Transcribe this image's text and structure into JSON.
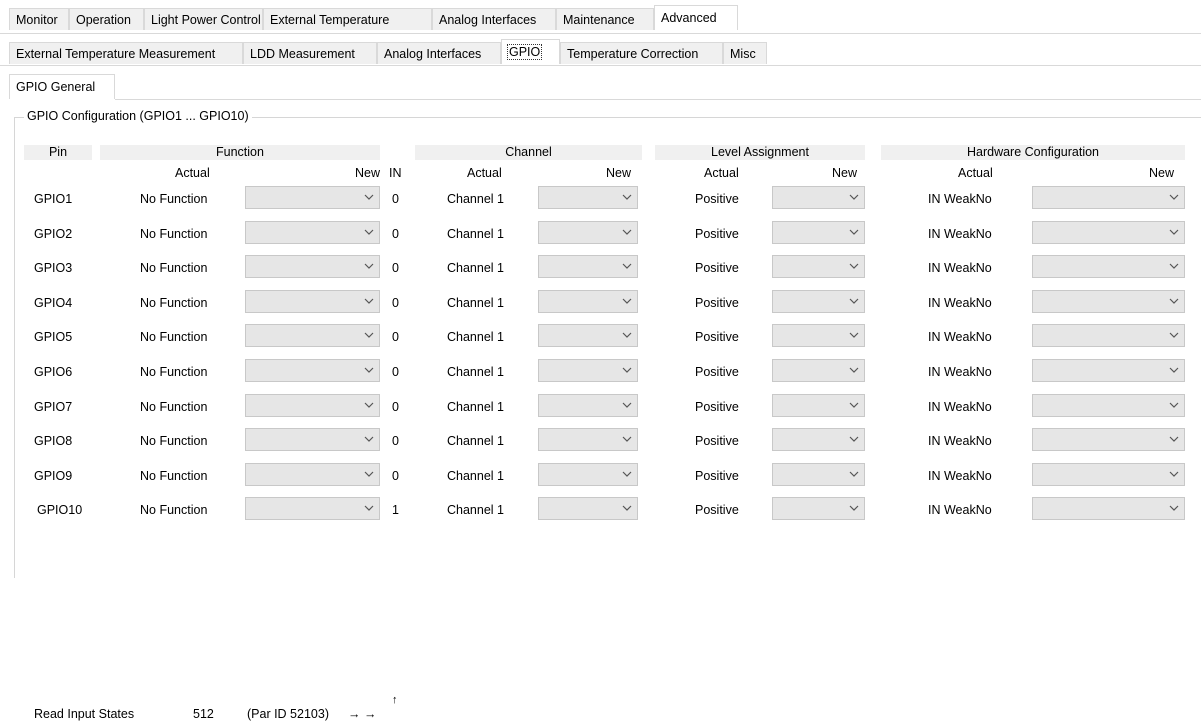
{
  "tabs_main": [
    "Monitor",
    "Operation",
    "Light Power Control",
    "External Temperature",
    "Analog Interfaces",
    "Maintenance",
    "Advanced"
  ],
  "tabs_sub": [
    "External Temperature Measurement",
    "LDD Measurement",
    "Analog Interfaces",
    "GPIO",
    "Temperature Correction",
    "Misc"
  ],
  "tabs_third": [
    "GPIO General"
  ],
  "group_title": "GPIO Configuration (GPIO1 ... GPIO10)",
  "headers": {
    "pin": "Pin",
    "function": "Function",
    "channel": "Channel",
    "level": "Level Assignment",
    "hardware": "Hardware Configuration"
  },
  "subheaders": {
    "fn_actual": "Actual",
    "fn_new": "New",
    "in": "IN",
    "ch_actual": "Actual",
    "ch_new": "New",
    "lv_actual": "Actual",
    "lv_new": "New",
    "hw_actual": "Actual",
    "hw_new": "New"
  },
  "rows": [
    {
      "pin": "GPIO1",
      "function": "No Function",
      "in": "0",
      "channel": "Channel 1",
      "level": "Positive",
      "hardware": "IN WeakNo"
    },
    {
      "pin": "GPIO2",
      "function": "No Function",
      "in": "0",
      "channel": "Channel 1",
      "level": "Positive",
      "hardware": "IN WeakNo"
    },
    {
      "pin": "GPIO3",
      "function": "No Function",
      "in": "0",
      "channel": "Channel 1",
      "level": "Positive",
      "hardware": "IN WeakNo"
    },
    {
      "pin": "GPIO4",
      "function": "No Function",
      "in": "0",
      "channel": "Channel 1",
      "level": "Positive",
      "hardware": "IN WeakNo"
    },
    {
      "pin": "GPIO5",
      "function": "No Function",
      "in": "0",
      "channel": "Channel 1",
      "level": "Positive",
      "hardware": "IN WeakNo"
    },
    {
      "pin": "GPIO6",
      "function": "No Function",
      "in": "0",
      "channel": "Channel 1",
      "level": "Positive",
      "hardware": "IN WeakNo"
    },
    {
      "pin": "GPIO7",
      "function": "No Function",
      "in": "0",
      "channel": "Channel 1",
      "level": "Positive",
      "hardware": "IN WeakNo"
    },
    {
      "pin": "GPIO8",
      "function": "No Function",
      "in": "0",
      "channel": "Channel 1",
      "level": "Positive",
      "hardware": "IN WeakNo"
    },
    {
      "pin": "GPIO9",
      "function": "No Function",
      "in": "0",
      "channel": "Channel 1",
      "level": "Positive",
      "hardware": "IN WeakNo"
    },
    {
      "pin": "GPIO10",
      "function": "No Function",
      "in": "1",
      "channel": "Channel 1",
      "level": "Positive",
      "hardware": "IN WeakNo"
    }
  ],
  "footer": {
    "label": "Read Input States",
    "value": "512",
    "par_id": "(Par ID 52103)",
    "arrows": "→ →",
    "up_arrow": "↑"
  },
  "icons": {
    "combo_arrow": "chevron-down-icon"
  },
  "colors": {
    "combo_bg": "#e6e6e6",
    "header_bg": "#f0f0f0",
    "tab_bg": "#f0f0f0"
  }
}
